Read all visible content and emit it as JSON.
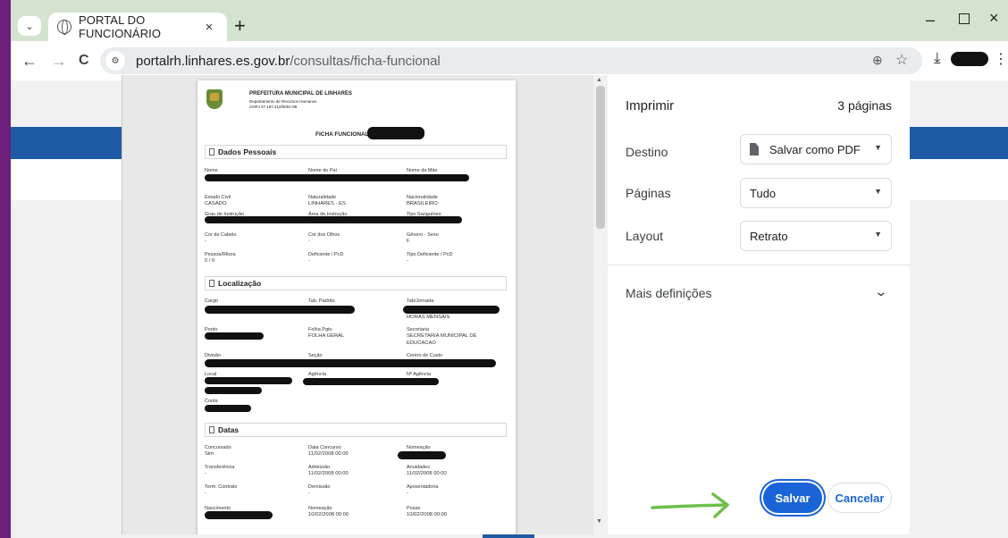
{
  "browser": {
    "tab_title": "PORTAL DO FUNCIONÁRIO",
    "tab_close": "×",
    "new_tab": "+",
    "url_domain": "portalrh.linhares.es.gov.br",
    "url_path": "/consultas/ficha-funcional",
    "nav": {
      "back": "←",
      "forward": "→",
      "reload": "C"
    },
    "icons": [
      "tab-search-icon",
      "globe-icon",
      "site-info-icon",
      "zoom-icon",
      "star-icon",
      "download-icon",
      "menu-icon"
    ],
    "window": {
      "minimize": "–",
      "close": "×"
    }
  },
  "print_dialog": {
    "title": "Imprimir",
    "page_count": "3 páginas",
    "destination_label": "Destino",
    "destination_value": "Salvar como PDF",
    "pages_label": "Páginas",
    "pages_value": "Tudo",
    "layout_label": "Layout",
    "layout_value": "Retrato",
    "more_settings": "Mais definições",
    "save_button": "Salvar",
    "cancel_button": "Cancelar",
    "accent_color": "#1a64d8",
    "arrow_color": "#6cc04a"
  },
  "preview": {
    "org_name": "PREFEITURA MUNICIPAL DE LINHARES",
    "org_dept": "Departamento de Recursos Humanos",
    "org_cnpj": "CNPJ 27.167.410/0001-88",
    "doc_title": "FICHA FUNCIONAL",
    "sections": {
      "dados": "Dados Pessoais",
      "localizacao": "Localização",
      "datas": "Datas"
    },
    "dados": {
      "nome": "Nome",
      "nome_pai": "Nome do Pai",
      "nome_mae": "Nome da Mãe",
      "estado_civil": "Estado Civil",
      "estado_civil_val": "CASADO",
      "naturalidade": "Naturalidade",
      "naturalidade_val": "LINHARES - ES",
      "nacionalidade": "Nacionalidade",
      "nacionalidade_val": "BRASILEIRO",
      "grau": "Grau de Instrução",
      "area": "Área de Instrução",
      "tipo_sang": "Tipo Sanguíneo",
      "cabelo": "Cor de Cabelo",
      "cabelo_val": "-",
      "olhos": "Cor dos Olhos",
      "olhos_val": "-",
      "genero": "Gênero - Sexo",
      "genero_val": "F",
      "pessoa": "Pessoa/Ritura",
      "pessoa_val": "0 / 0",
      "deficiente": "Deficiente / PcD",
      "deficiente_val": "-",
      "tipo_def": "Tipo Deficiente / PcD",
      "tipo_def_val": "-"
    },
    "local": {
      "cargo": "Cargo",
      "tab_padrao": "Tab. Padrão",
      "tab_jornada": "Tab/Jornada",
      "jornada_val": "HORAS MENSAIS",
      "ponto": "Ponto",
      "folha": "Folha Pgto",
      "folha_val": "FOLHA GERAL",
      "secretaria": "Secretaria",
      "secretaria_val1": "SECRETARIA MUNICIPAL DE",
      "secretaria_val2": "EDUCACAO",
      "divisao": "Divisão",
      "secao": "Seção",
      "centro": "Centro de Custo",
      "local": "Local",
      "agencia": "Agência",
      "n_agencia": "Nº Agência",
      "conta": "Conta"
    },
    "datas": {
      "concursado": "Concursado",
      "concursado_val": "Sim",
      "data_concurso": "Data Concurso",
      "data_concurso_val": "11/02/2008 00:00",
      "nomeacao": "Nomeação",
      "transferencia": "Transferência",
      "transferencia_val": "-",
      "admissao": "Admissão",
      "admissao_val": "11/02/2008 00:00",
      "anuidades": "Anuidades",
      "anuidades_val": "11/02/2008 00:00",
      "term": "Term. Contrato",
      "term_val": "-",
      "demissao": "Demissão",
      "demissao_val": "-",
      "aposentadoria": "Aposentadoria",
      "aposentadoria_val": "-",
      "nascimento": "Nascimento",
      "nomeacao2": "Nomeação",
      "nomeacao2_val": "10/02/2008 00:00",
      "posse": "Posse",
      "posse_val": "10/02/2008 00:00"
    }
  }
}
